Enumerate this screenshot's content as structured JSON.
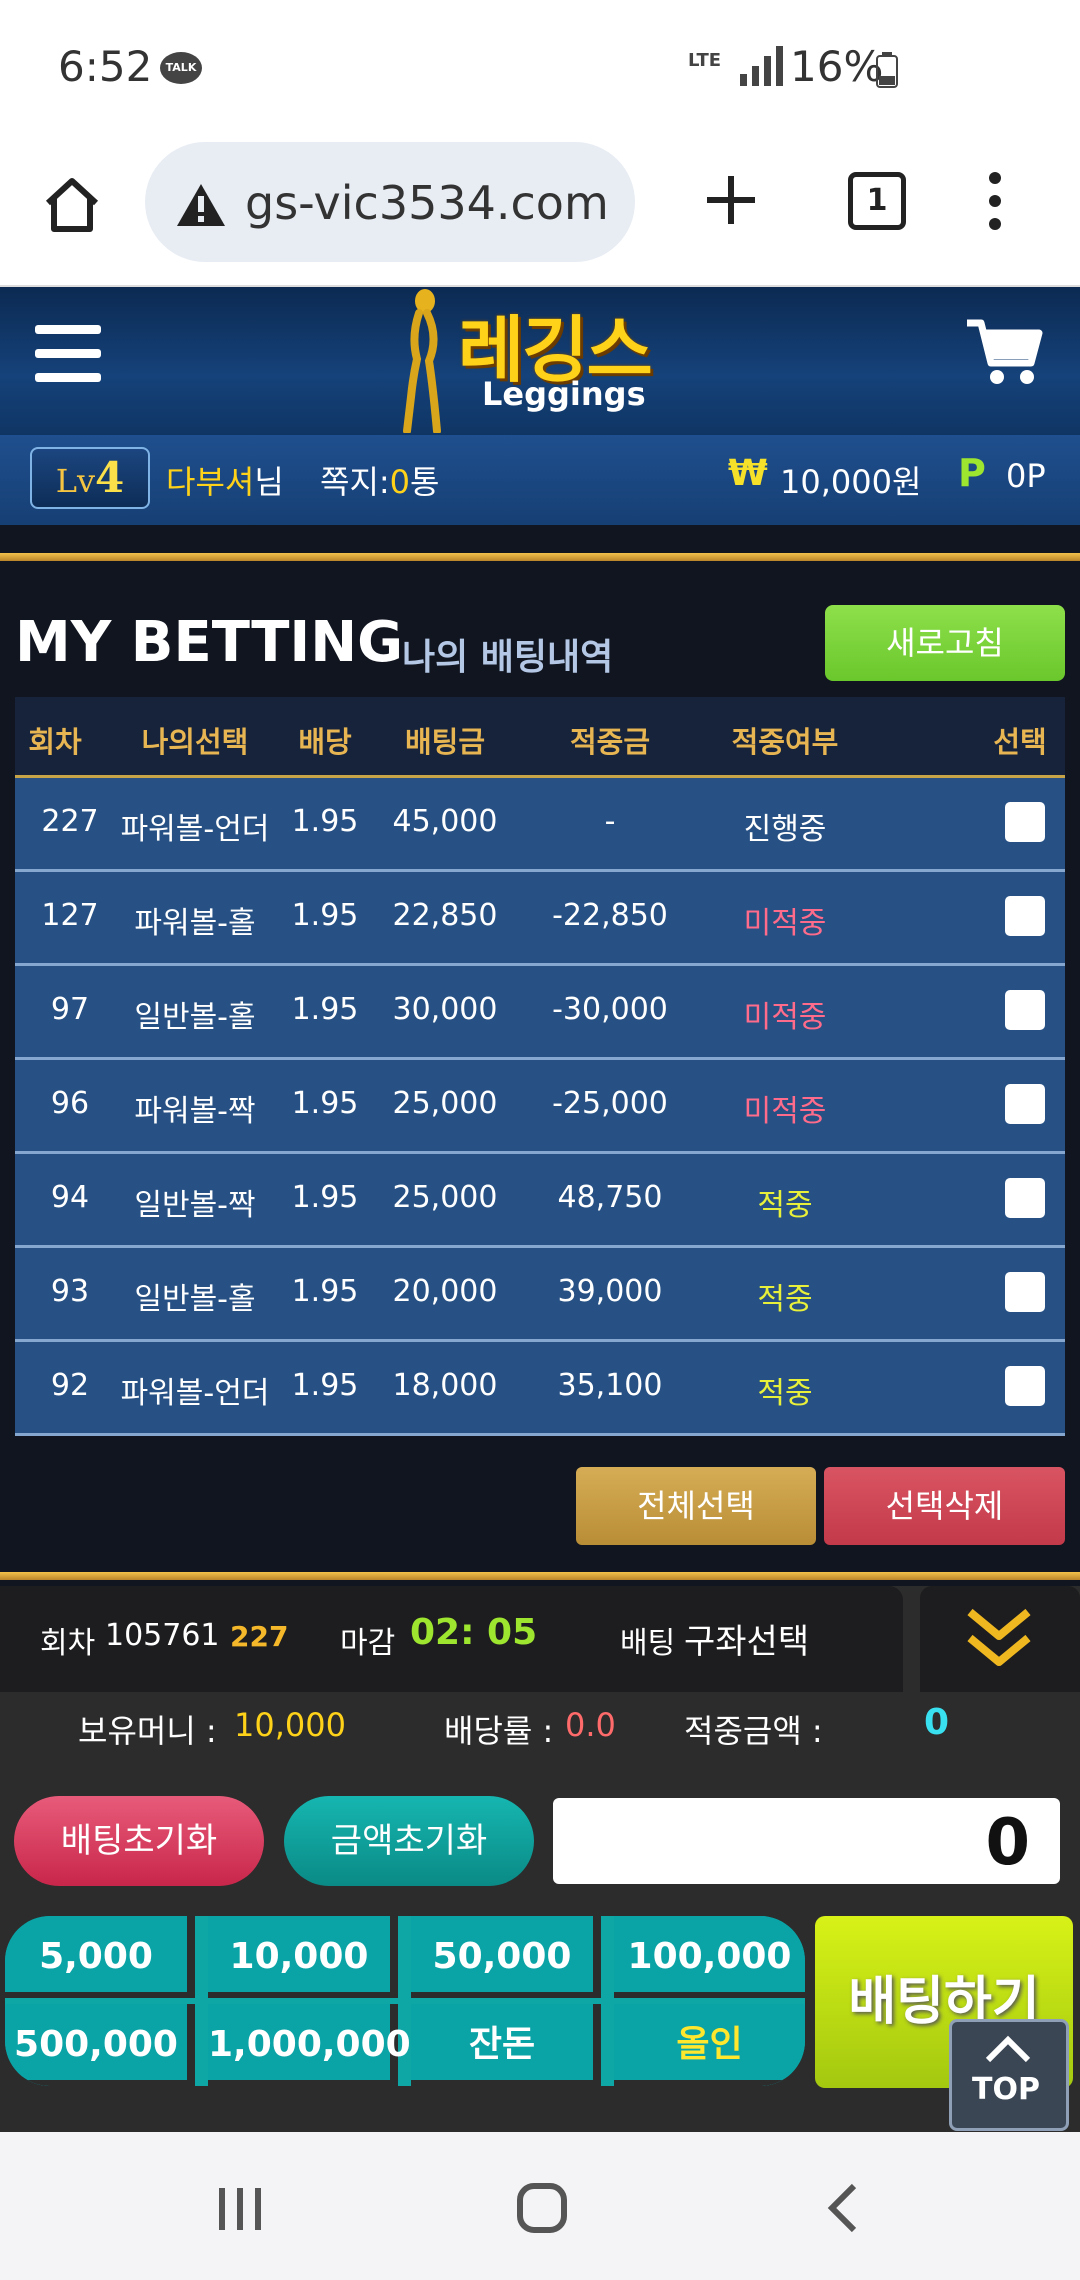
{
  "status_bar": {
    "time": "6:52",
    "talk_badge": "TALK",
    "network": "LTE",
    "battery": "16%"
  },
  "browser": {
    "url": "gs-vic3534.com",
    "tab_count": "1"
  },
  "site": {
    "logo_korean": "레깅스",
    "logo_english": "Leggings"
  },
  "user": {
    "level_prefix": "Lv",
    "level_number": "4",
    "name": "다부셔",
    "name_suffix": "님",
    "note_label": "쪽지:",
    "note_count": "0",
    "note_unit": "통",
    "currency_symbol": "₩",
    "money": "10,000원",
    "point_symbol": "P",
    "points": "0P"
  },
  "betting": {
    "title": "MY BETTING",
    "subtitle": "나의 배팅내역",
    "refresh_label": "새로고침",
    "columns": [
      "회차",
      "나의선택",
      "배당",
      "배팅금",
      "적중금",
      "적중여부",
      "선택"
    ],
    "rows": [
      {
        "round": "227",
        "choice": "파워볼-언더",
        "odds": "1.95",
        "bet": "45,000",
        "win": "-",
        "result": "진행중",
        "status": "progress"
      },
      {
        "round": "127",
        "choice": "파워볼-홀",
        "odds": "1.95",
        "bet": "22,850",
        "win": "-22,850",
        "result": "미적중",
        "status": "miss"
      },
      {
        "round": "97",
        "choice": "일반볼-홀",
        "odds": "1.95",
        "bet": "30,000",
        "win": "-30,000",
        "result": "미적중",
        "status": "miss"
      },
      {
        "round": "96",
        "choice": "파워볼-짝",
        "odds": "1.95",
        "bet": "25,000",
        "win": "-25,000",
        "result": "미적중",
        "status": "miss"
      },
      {
        "round": "94",
        "choice": "일반볼-짝",
        "odds": "1.95",
        "bet": "25,000",
        "win": "48,750",
        "result": "적중",
        "status": "hit"
      },
      {
        "round": "93",
        "choice": "일반볼-홀",
        "odds": "1.95",
        "bet": "20,000",
        "win": "39,000",
        "result": "적중",
        "status": "hit"
      },
      {
        "round": "92",
        "choice": "파워볼-언더",
        "odds": "1.95",
        "bet": "18,000",
        "win": "35,100",
        "result": "적중",
        "status": "hit"
      }
    ],
    "select_all_label": "전체선택",
    "delete_label": "선택삭제"
  },
  "panel": {
    "round_label": "회차",
    "round_value": "105761",
    "round_short": "227",
    "deadline_label": "마감",
    "deadline_value": "02: 05",
    "bet_label": "배팅",
    "bet_value": "구좌선택",
    "holdings_label": "보유머니 :",
    "holdings_value": "10,000",
    "odds_label": "배당률 :",
    "odds_value": "0.0",
    "payout_label": "적중금액 :",
    "payout_value": "0",
    "reset_bet_label": "배팅초기화",
    "reset_amount_label": "금액초기화",
    "amount_value": "0",
    "chips": [
      "5,000",
      "10,000",
      "50,000",
      "100,000",
      "500,000",
      "1,000,000",
      "잔돈",
      "올인"
    ],
    "bet_button_label": "배팅하기",
    "top_label": "TOP"
  },
  "colors": {
    "miss": "#ff6b8a",
    "hit": "#e8f03a",
    "progress": "#ffffff",
    "gold": "#e8b553"
  }
}
